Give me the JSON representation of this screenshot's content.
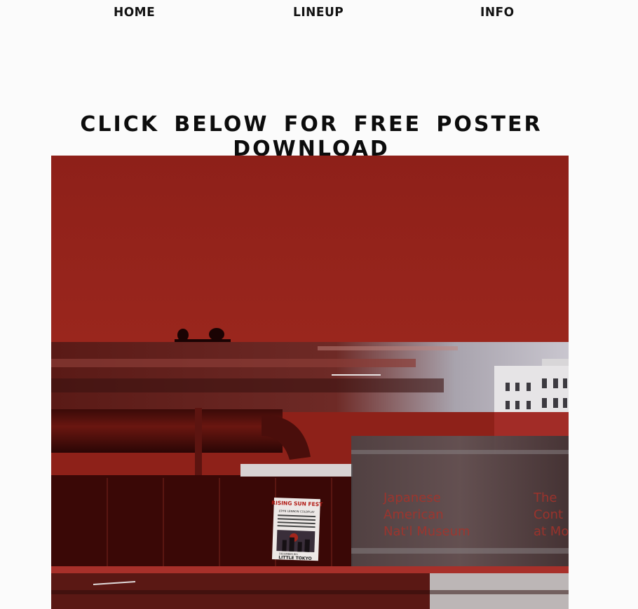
{
  "nav": {
    "items": [
      {
        "label": "HOME"
      },
      {
        "label": "LINEUP"
      },
      {
        "label": "INFO"
      }
    ]
  },
  "headline": "CLICK BELOW FOR FREE POSTER DOWNLOAD",
  "poster_photo": {
    "poster": {
      "title": "RISING SUN FEST",
      "lineup_line": "JOHN LENNON  COLDPLAY",
      "date": "DECEMBER 8th",
      "location": "LITTLE TOKYO"
    },
    "signage": {
      "left_lines": [
        "Japanese",
        "American",
        "Nat'l Museum"
      ],
      "right_lines": [
        "The",
        "Cont",
        "at Mo"
      ]
    }
  },
  "colors": {
    "accent_red": "#8a2018",
    "text_dark": "#0c0c0c",
    "background": "#fbfbfb"
  }
}
